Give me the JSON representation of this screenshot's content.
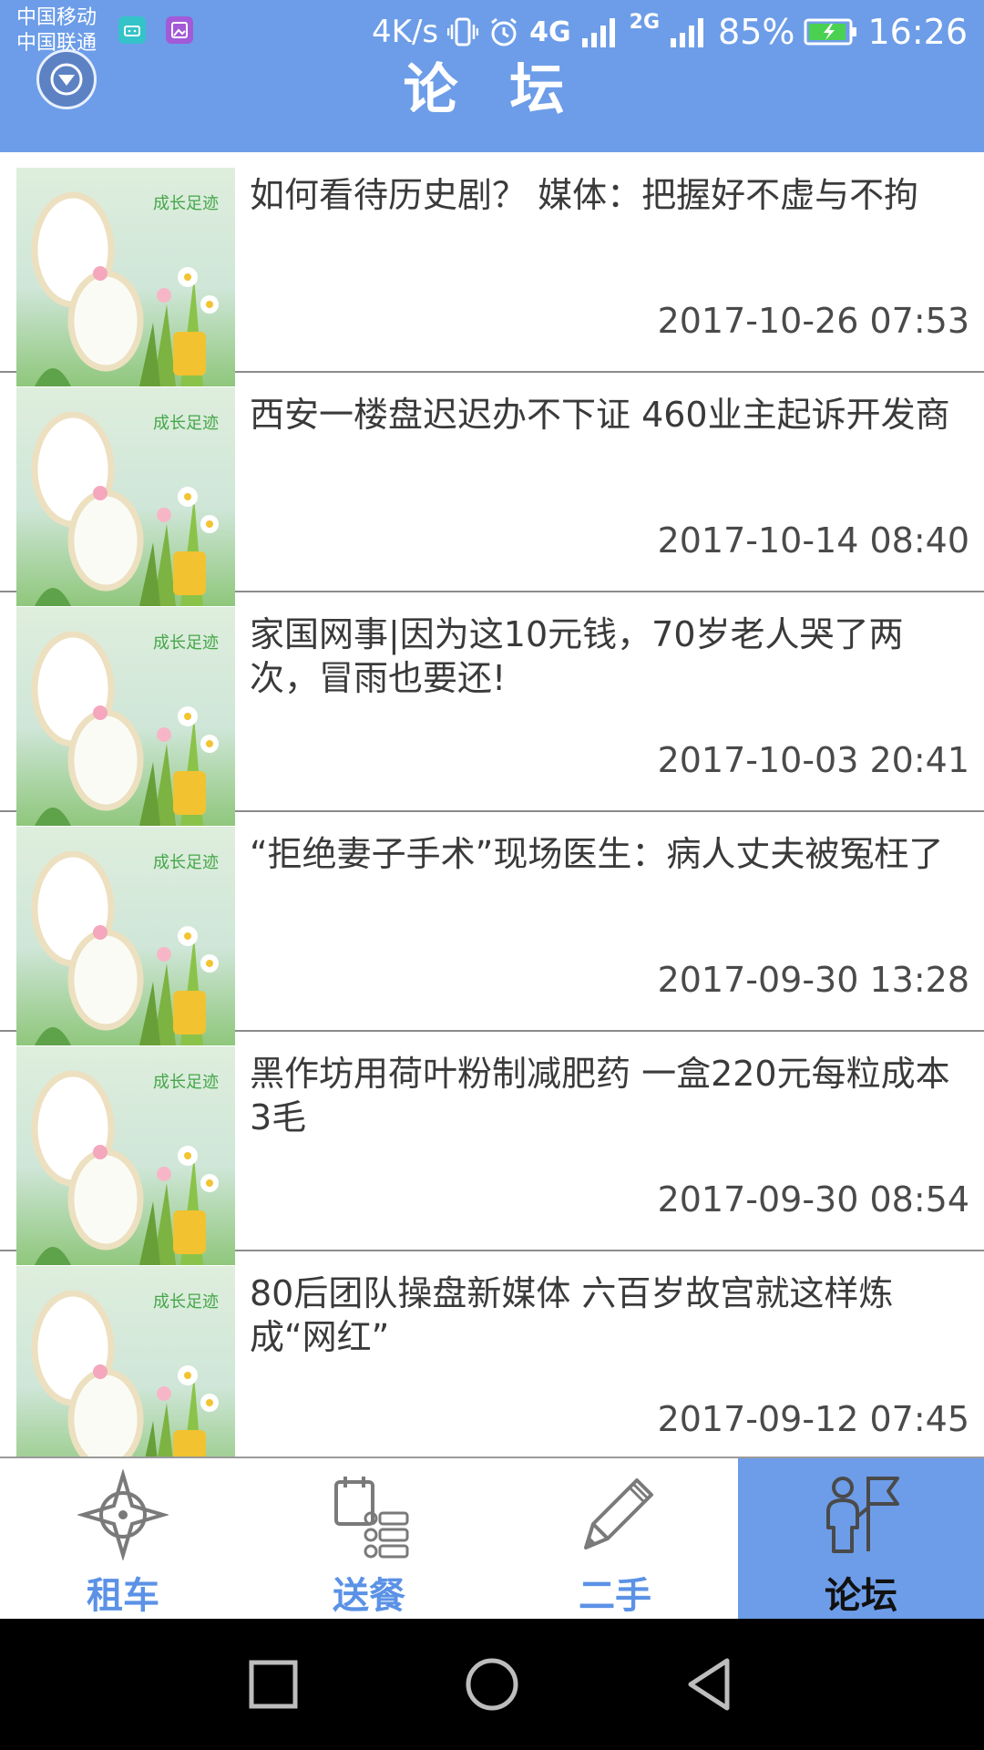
{
  "status_bar": {
    "carrier_1": "中国移动",
    "carrier_2": "中国联通",
    "net_speed": "4K/s",
    "net_4g_label": "4G",
    "net_2g_label": "2G",
    "battery": "85%",
    "time": "16:26"
  },
  "header": {
    "title": "论 坛",
    "dropdown_icon": "chevron-down-circle-icon",
    "background": "#6d9de8"
  },
  "news": [
    {
      "title": "如何看待历史剧？ 媒体：把握好不虚与不拘",
      "date": "2017-10-26 07:53"
    },
    {
      "title": "西安一楼盘迟迟办不下证 460业主起诉开发商",
      "date": "2017-10-14 08:40"
    },
    {
      "title": "家国网事|因为这10元钱，70岁老人哭了两次，冒雨也要还!",
      "date": "2017-10-03 20:41"
    },
    {
      "title": "“拒绝妻子手术”现场医生：病人丈夫被冤枉了",
      "date": "2017-09-30 13:28"
    },
    {
      "title": "黑作坊用荷叶粉制减肥药 一盒220元每粒成本3毛",
      "date": "2017-09-30 08:54"
    },
    {
      "title": "80后团队操盘新媒体 六百岁故宫就这样炼成“网红”",
      "date": "2017-09-12 07:45"
    }
  ],
  "tabs": [
    {
      "label": "租车",
      "icon": "compass-icon",
      "active": false
    },
    {
      "label": "送餐",
      "icon": "clipboard-list-icon",
      "active": false
    },
    {
      "label": "二手",
      "icon": "pencil-icon",
      "active": false
    },
    {
      "label": "论坛",
      "icon": "person-flag-icon",
      "active": true
    }
  ],
  "system_nav": {
    "icons": [
      "square-recent-icon",
      "circle-home-icon",
      "triangle-back-icon"
    ]
  },
  "colors": {
    "accent": "#6d9de8",
    "tab_label": "#5b92e6",
    "divider": "#8c8c8c"
  }
}
